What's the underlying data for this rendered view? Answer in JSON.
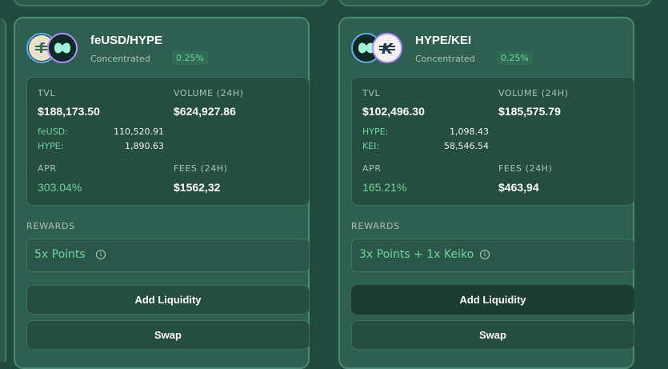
{
  "pools": [
    {
      "pair": "feUSD/HYPE",
      "token_a_icon": "feusd-icon",
      "token_b_icon": "hype-icon",
      "pool_type": "Concentrated",
      "fee_tier": "0.25%",
      "tvl_label": "TVL",
      "tvl": "$188,173.50",
      "volume_label": "VOLUME (24H)",
      "volume": "$624,927.86",
      "reserves": [
        {
          "token": "feUSD:",
          "amount": "110,520.91"
        },
        {
          "token": "HYPE:",
          "amount": "1,890.63"
        }
      ],
      "apr_label": "APR",
      "apr": "303.04%",
      "fees_label": "FEES (24H)",
      "fees": "$1562,32",
      "rewards_label": "REWARDS",
      "rewards": "5x Points",
      "add_liquidity_label": "Add Liquidity",
      "swap_label": "Swap"
    },
    {
      "pair": "HYPE/KEI",
      "token_a_icon": "hype-icon",
      "token_b_icon": "kei-icon",
      "pool_type": "Concentrated",
      "fee_tier": "0.25%",
      "tvl_label": "TVL",
      "tvl": "$102,496.30",
      "volume_label": "VOLUME (24H)",
      "volume": "$185,575.79",
      "reserves": [
        {
          "token": "HYPE:",
          "amount": "1,098.43"
        },
        {
          "token": "KEI:",
          "amount": "58,546.54"
        }
      ],
      "apr_label": "APR",
      "apr": "165.21%",
      "fees_label": "FEES (24H)",
      "fees": "$463,94",
      "rewards_label": "REWARDS",
      "rewards": "3x Points + 1x Keiko",
      "add_liquidity_label": "Add Liquidity",
      "swap_label": "Swap"
    }
  ],
  "info_glyph": "i",
  "colors": {
    "background": "#1f4a3d",
    "card": "#2f5f50",
    "card_border": "#4a8c72",
    "accent_green": "#6fd59d"
  }
}
